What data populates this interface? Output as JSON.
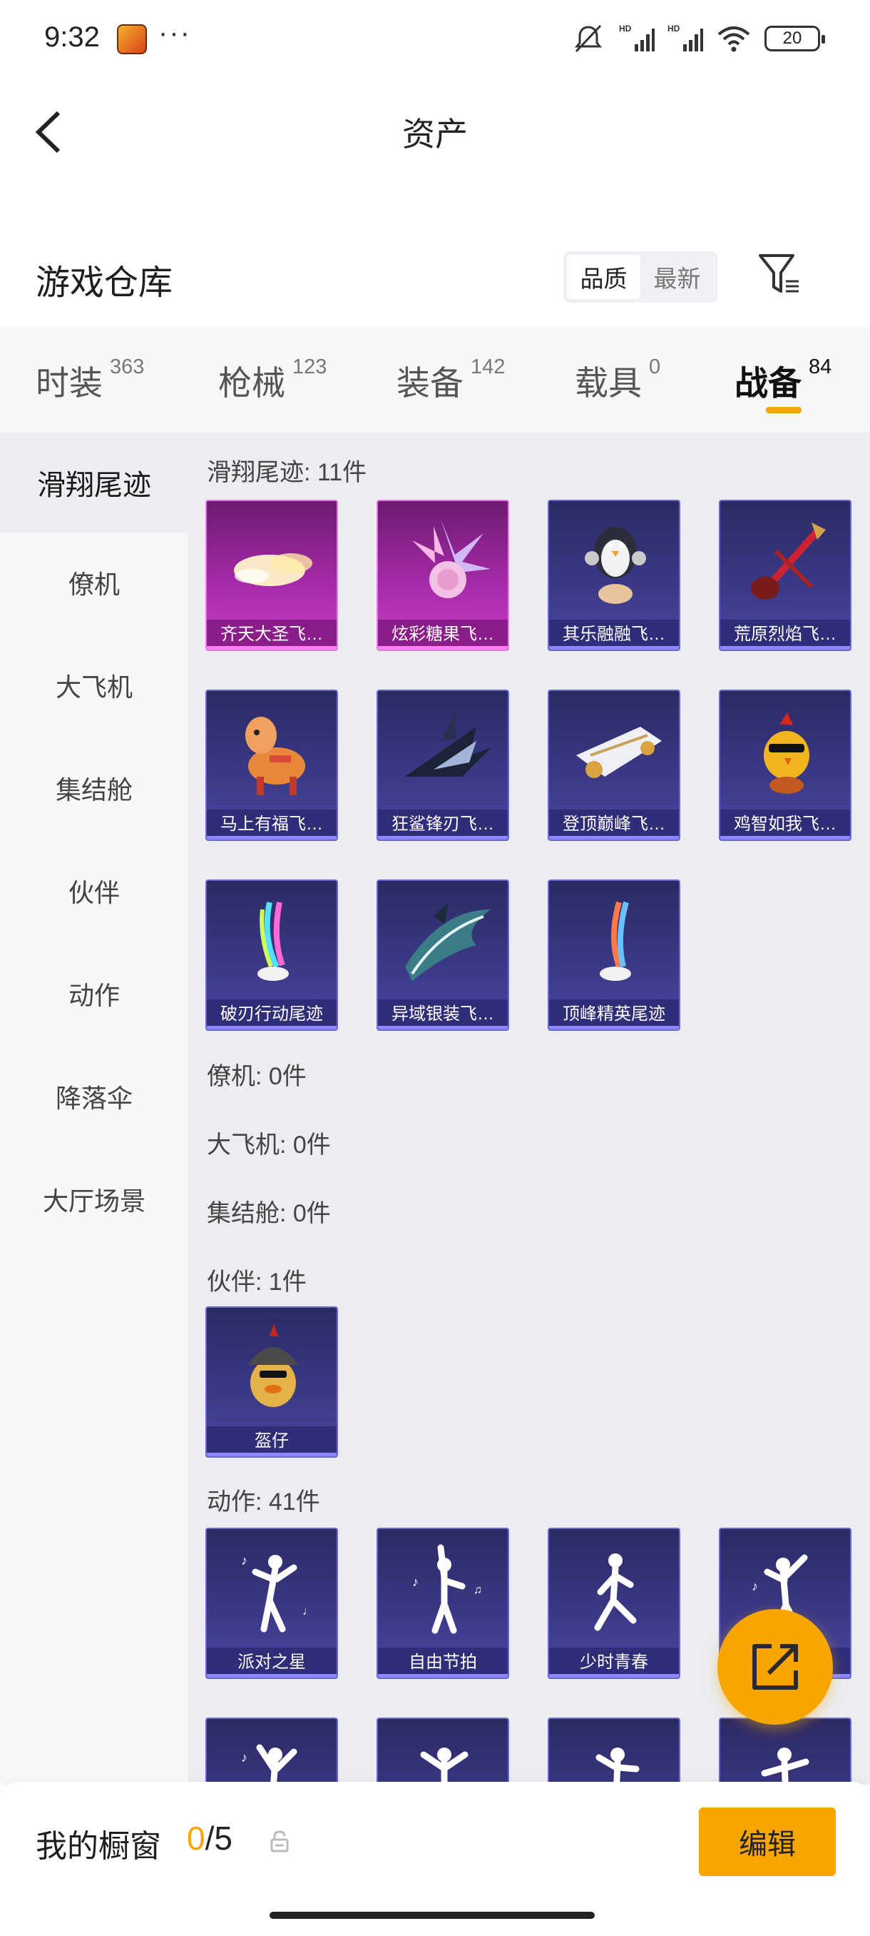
{
  "status_bar": {
    "time": "9:32",
    "dots": "···",
    "battery": "20"
  },
  "header": {
    "title": "资产"
  },
  "warehouse": {
    "title": "游戏仓库",
    "sort_options": [
      {
        "label": "品质",
        "active": true
      },
      {
        "label": "最新",
        "active": false
      }
    ]
  },
  "tabs": [
    {
      "label": "时装",
      "count": "363",
      "active": false
    },
    {
      "label": "枪械",
      "count": "123",
      "active": false
    },
    {
      "label": "装备",
      "count": "142",
      "active": false
    },
    {
      "label": "载具",
      "count": "0",
      "active": false
    },
    {
      "label": "战备",
      "count": "84",
      "active": true
    }
  ],
  "sidebar": {
    "items": [
      {
        "label": "滑翔尾迹",
        "active": true
      },
      {
        "label": "僚机",
        "active": false
      },
      {
        "label": "大飞机",
        "active": false
      },
      {
        "label": "集结舱",
        "active": false
      },
      {
        "label": "伙伴",
        "active": false
      },
      {
        "label": "动作",
        "active": false
      },
      {
        "label": "降落伞",
        "active": false
      },
      {
        "label": "大厅场景",
        "active": false
      }
    ]
  },
  "sections": {
    "glide": {
      "title": "滑翔尾迹: 11件",
      "items": [
        {
          "name": "齐天大圣飞…",
          "rarity": "pink",
          "icon": "cloud-icon"
        },
        {
          "name": "炫彩糖果飞…",
          "rarity": "pink",
          "icon": "candy-icon"
        },
        {
          "name": "其乐融融飞…",
          "rarity": "purple",
          "icon": "penguin-icon"
        },
        {
          "name": "荒原烈焰飞…",
          "rarity": "purple",
          "icon": "guitar-icon"
        },
        {
          "name": "马上有福飞…",
          "rarity": "purple",
          "icon": "horse-icon"
        },
        {
          "name": "狂鲨锋刃飞…",
          "rarity": "purple",
          "icon": "shark-icon"
        },
        {
          "name": "登顶巅峰飞…",
          "rarity": "purple",
          "icon": "jet-icon"
        },
        {
          "name": "鸡智如我飞…",
          "rarity": "purple",
          "icon": "chicken-icon"
        },
        {
          "name": "破刃行动尾迹",
          "rarity": "purple",
          "icon": "trail-icon"
        },
        {
          "name": "异域银装飞…",
          "rarity": "purple",
          "icon": "wing-icon"
        },
        {
          "name": "顶峰精英尾迹",
          "rarity": "purple",
          "icon": "trail-icon"
        }
      ]
    },
    "wingman": {
      "title": "僚机: 0件"
    },
    "plane": {
      "title": "大飞机: 0件"
    },
    "pod": {
      "title": "集结舱: 0件"
    },
    "partner": {
      "title": "伙伴: 1件",
      "items": [
        {
          "name": "盔仔",
          "rarity": "purple",
          "icon": "helmet-chick-icon"
        }
      ]
    },
    "emote": {
      "title": "动作: 41件",
      "items": [
        {
          "name": "派对之星",
          "icon": "dancer-icon"
        },
        {
          "name": "自由节拍",
          "icon": "dancer-icon"
        },
        {
          "name": "少时青春",
          "icon": "dancer-icon"
        },
        {
          "name": "",
          "icon": "dancer-icon"
        },
        {
          "name": "",
          "icon": "dancer-icon"
        },
        {
          "name": "",
          "icon": "dancer-icon"
        },
        {
          "name": "",
          "icon": "dancer-icon"
        },
        {
          "name": "",
          "icon": "dancer-icon"
        }
      ]
    }
  },
  "showcase": {
    "label": "我的橱窗",
    "used": "0",
    "total": "/5",
    "edit_label": "编辑"
  },
  "colors": {
    "accent": "#f7a600",
    "card_purple": "#3a3884",
    "card_pink": "#a52aa8"
  }
}
